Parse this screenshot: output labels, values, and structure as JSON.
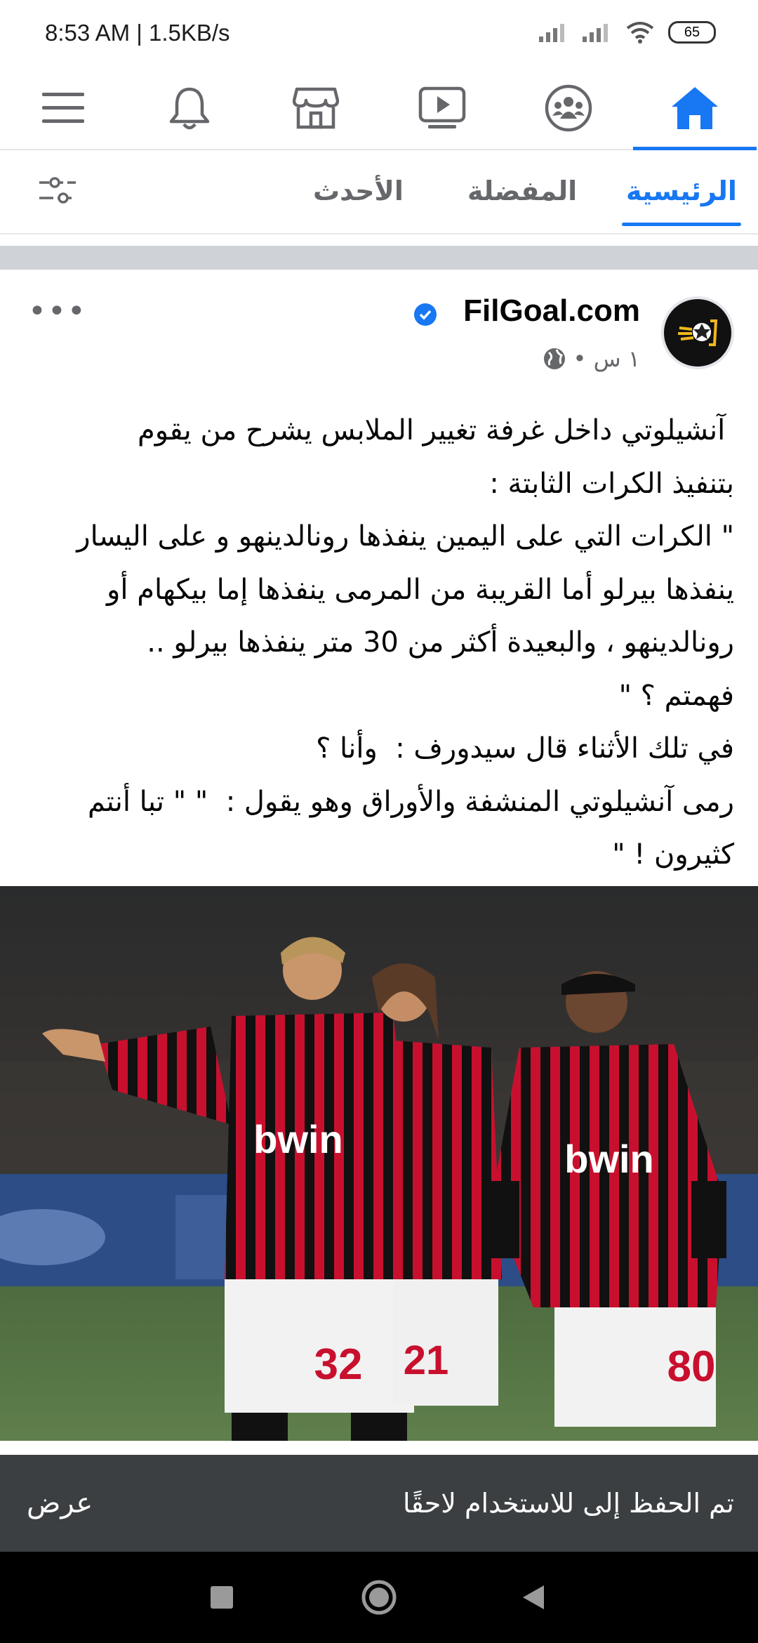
{
  "status_bar": {
    "time": "8:53 AM | 1.5KB/s",
    "battery": "65"
  },
  "top_nav": {
    "items": [
      {
        "icon": "menu-icon"
      },
      {
        "icon": "bell-icon"
      },
      {
        "icon": "marketplace-icon"
      },
      {
        "icon": "video-icon"
      },
      {
        "icon": "groups-icon"
      },
      {
        "icon": "home-icon",
        "active": true
      }
    ],
    "accent": "#1877f2"
  },
  "feed_tabs": {
    "home": "الرئيسية",
    "favorites": "المفضلة",
    "recent": "الأحدث"
  },
  "post": {
    "page_name": "FilGoal.com",
    "time": "١ س •",
    "text_lines": [
      " آنشيلوتي داخل غرفة تغيير الملابس يشرح من يقوم",
      "بتنفيذ الكرات الثابتة :",
      "\" الكرات التي على اليمين ينفذها رونالدينهو و على اليسار",
      "ينفذها بيرلو أما القريبة من المرمى ينفذها إما بيكهام أو",
      "رونالدينهو ، والبعيدة أكثر من 30 متر ينفذها بيرلو ..",
      "فهمتم ؟ \"",
      "في تلك الأثناء قال سيدورف :  وأنا ؟",
      "رمى آنشيلوتي المنشفة والأوراق وهو يقول :  \" \" تبا أنتم",
      "كثيرون ! \""
    ],
    "photo": {
      "jersey_text": "bwin",
      "numbers": [
        "32",
        "21",
        "80"
      ]
    }
  },
  "snackbar": {
    "message": "تم الحفظ إلى للاستخدام لاحقًا",
    "action": "عرض"
  }
}
